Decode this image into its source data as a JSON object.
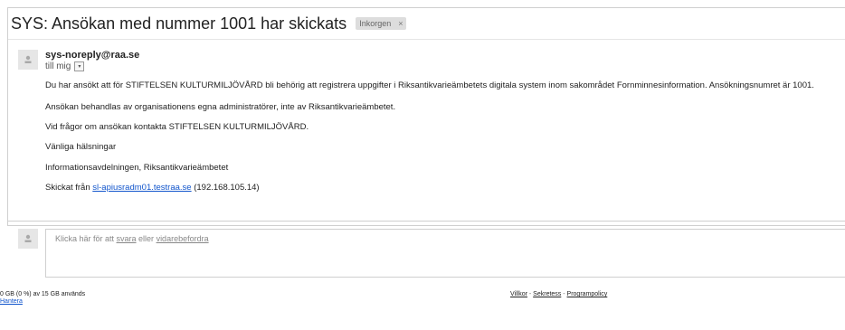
{
  "message": {
    "subject": "SYS: Ansökan med nummer 1001 har skickats",
    "label": "Inkorgen",
    "label_close": "×",
    "sender": "sys-noreply@raa.se",
    "to": "till mig",
    "to_dropdown": "▾",
    "body": {
      "line1": "Du har ansökt att för STIFTELSEN KULTURMILJÖVÅRD bli behörig att registrera uppgifter i Riksantikvarieämbetets digitala system inom sakområdet Fornminnesinformation. Ansökningsnumret är 1001.",
      "line2": "Ansökan behandlas av organisationens egna administratörer, inte av Riksantikvarieämbetet.",
      "line3": "Vid frågor om ansökan kontakta STIFTELSEN KULTURMILJÖVÅRD.",
      "line4": "Vänliga hälsningar",
      "line5": "Informationsavdelningen, Riksantikvarieämbetet",
      "line6_prefix": "Skickat från ",
      "line6_link": "sl-apiusradm01.testraa.se",
      "line6_suffix": " (192.168.105.14)"
    }
  },
  "reply": {
    "prefix": "Klicka här för att ",
    "reply_link": "svara",
    "middle": " eller ",
    "forward_link": "vidarebefordra"
  },
  "footer": {
    "storage": "0 GB (0 %) av 15 GB används",
    "manage": "Hantera",
    "terms": "Villkor",
    "sep1": " - ",
    "privacy": "Sekretess",
    "sep2": " - ",
    "policy": "Programpolicy"
  }
}
